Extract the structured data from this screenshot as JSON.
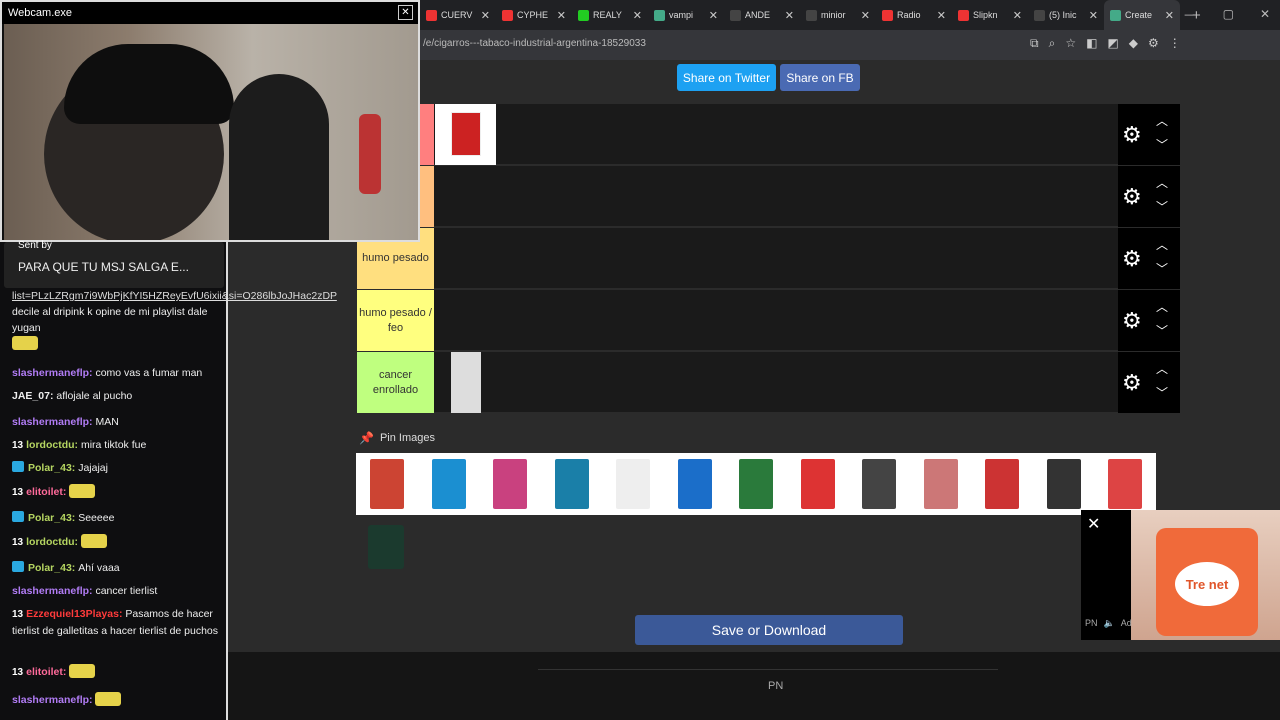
{
  "browser": {
    "tabs": [
      {
        "label": "CUERV",
        "color": "#e33"
      },
      {
        "label": "CYPHE",
        "color": "#e33"
      },
      {
        "label": "REALY",
        "color": "#2c2"
      },
      {
        "label": "vampi",
        "color": "#4a8"
      },
      {
        "label": "ANDE",
        "color": "#444"
      },
      {
        "label": "minior",
        "color": "#444"
      },
      {
        "label": "Radio",
        "color": "#e33"
      },
      {
        "label": "Slipkn",
        "color": "#e33"
      },
      {
        "label": "(5) Inic",
        "color": "#444"
      },
      {
        "label": "Create",
        "color": "#4a8"
      }
    ],
    "url": "/e/cigarros---tabaco-industrial-argentina-18529033"
  },
  "share": {
    "twitter": "Share on Twitter",
    "fb": "Share on FB"
  },
  "tiers": [
    {
      "label": "",
      "color": "#ff7f7f"
    },
    {
      "label": "",
      "color": "#ffbf7f"
    },
    {
      "label": "humo pesado",
      "color": "#ffdf7f"
    },
    {
      "label": "humo pesado / feo",
      "color": "#ffff7f"
    },
    {
      "label": "cancer enrollado",
      "color": "#bfff7f"
    }
  ],
  "pin_label": "Pin Images",
  "pool_colors": [
    "#c43",
    "#1b8fd1",
    "#c9417f",
    "#1a7fa8",
    "#eee",
    "#1b6ec9",
    "#2a7a3b",
    "#d33",
    "#444",
    "#c77",
    "#c33",
    "#333",
    "#d44"
  ],
  "save_button": "Save or Download",
  "footer": {
    "pn": "PN"
  },
  "webcam": {
    "title": "Webcam.exe"
  },
  "chat": {
    "sent_by": "Sent by",
    "sent_msg": "PARA QUE TU MSJ SALGA E...",
    "link_text": "list=PLzLZRgm7i9WbPjKfYI5HZReyEvfU6ixii&si=O286lbJoJHac2zDP",
    "link_rest": "decile al dripink k opine de mi playlist dale yugan",
    "messages": [
      {
        "user": "slashermaneflp",
        "text": "como vas a fumar man"
      },
      {
        "user": "JAE_07",
        "text": "aflojale al pucho"
      },
      {
        "user": "slashermaneflp",
        "text": "MAN"
      },
      {
        "user": "lordoctdu",
        "text": "mira tiktok fue"
      },
      {
        "user": "Polar_43",
        "text": "Jajajaj"
      },
      {
        "user": "elitoilet",
        "text": ""
      },
      {
        "user": "Polar_43",
        "text": "Seeeee"
      },
      {
        "user": "lordoctdu",
        "text": ""
      },
      {
        "user": "Polar_43",
        "text": "Ahí vaaa"
      },
      {
        "user": "slashermaneflp",
        "text": "cancer tierlist"
      },
      {
        "user": "Ezzequiel13Playas",
        "text": "Pasamos de hacer tierlist de galletitas a hacer tierlist de puchos"
      },
      {
        "user": "elitoilet",
        "text": ""
      },
      {
        "user": "slashermaneflp",
        "text": ""
      }
    ]
  },
  "ad": {
    "brand": "Tre net",
    "ad_tag": "Ad",
    "pn": "PN"
  }
}
